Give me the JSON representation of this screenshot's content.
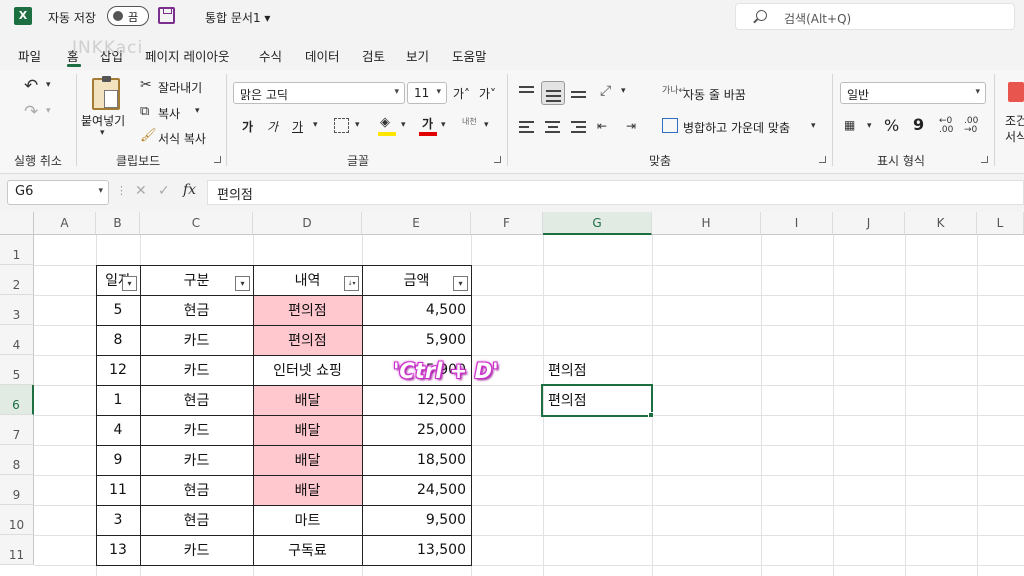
{
  "titlebar": {
    "logo": "X",
    "autosave_label": "자동 저장",
    "autosave_state": "끔",
    "doc_title": "통합 문서1 ▾",
    "search_placeholder": "검색(Alt+Q)"
  },
  "watermark": "INKKaci",
  "tabs": [
    "파일",
    "홈",
    "삽입",
    "페이지 레이아웃",
    "수식",
    "데이터",
    "검토",
    "보기",
    "도움말"
  ],
  "ribbon": {
    "undo_group": "실행 취소",
    "clipboard": {
      "paste": "붙여넣기",
      "cut": "잘라내기",
      "copy": "복사",
      "format_painter": "서식 복사",
      "label": "클립보드"
    },
    "font": {
      "name": "맑은 고딕",
      "size": "11",
      "grow": "가˄",
      "shrink": "가˅",
      "bold": "가",
      "italic": "가",
      "underline": "가",
      "label": "글꼴"
    },
    "alignment": {
      "wrap_text": "자동 줄 바꿈",
      "merge_center": "병합하고 가운데 맞춤",
      "label": "맞춤"
    },
    "number": {
      "format": "일반",
      "percent": "%",
      "comma": "9",
      "label": "표시 형식"
    },
    "styles": {
      "cond_line1": "조건",
      "cond_line2": "서식"
    }
  },
  "formula_bar": {
    "name_box": "G6",
    "fx": "fx",
    "cancel": "✕",
    "enter": "✓",
    "value": "편의점"
  },
  "columns": [
    "A",
    "B",
    "C",
    "D",
    "E",
    "F",
    "G",
    "H",
    "I",
    "J",
    "K",
    "L"
  ],
  "rows": [
    "1",
    "2",
    "3",
    "4",
    "5",
    "6",
    "7",
    "8",
    "9",
    "10",
    "11"
  ],
  "table": {
    "headers": [
      "일자",
      "구분",
      "내역",
      "금액"
    ],
    "rows": [
      [
        "5",
        "현금",
        "편의점",
        "4,500"
      ],
      [
        "8",
        "카드",
        "편의점",
        "5,900"
      ],
      [
        "12",
        "카드",
        "인터넷 쇼핑",
        "5,900"
      ],
      [
        "1",
        "현금",
        "배달",
        "12,500"
      ],
      [
        "4",
        "카드",
        "배달",
        "25,000"
      ],
      [
        "9",
        "카드",
        "배달",
        "18,500"
      ],
      [
        "11",
        "현금",
        "배달",
        "24,500"
      ],
      [
        "3",
        "현금",
        "마트",
        "9,500"
      ],
      [
        "13",
        "카드",
        "구독료",
        "13,500"
      ]
    ],
    "highlight_rows": [
      0,
      1,
      3,
      4,
      5,
      6
    ]
  },
  "side_cells": {
    "g5": "편의점",
    "g6": "편의점"
  },
  "overlay_label": "'Ctrl + D'",
  "colors": {
    "excel_green": "#1d6f42",
    "highlight_pink": "#ffc7ce",
    "overlay_magenta": "#d63ad6"
  }
}
